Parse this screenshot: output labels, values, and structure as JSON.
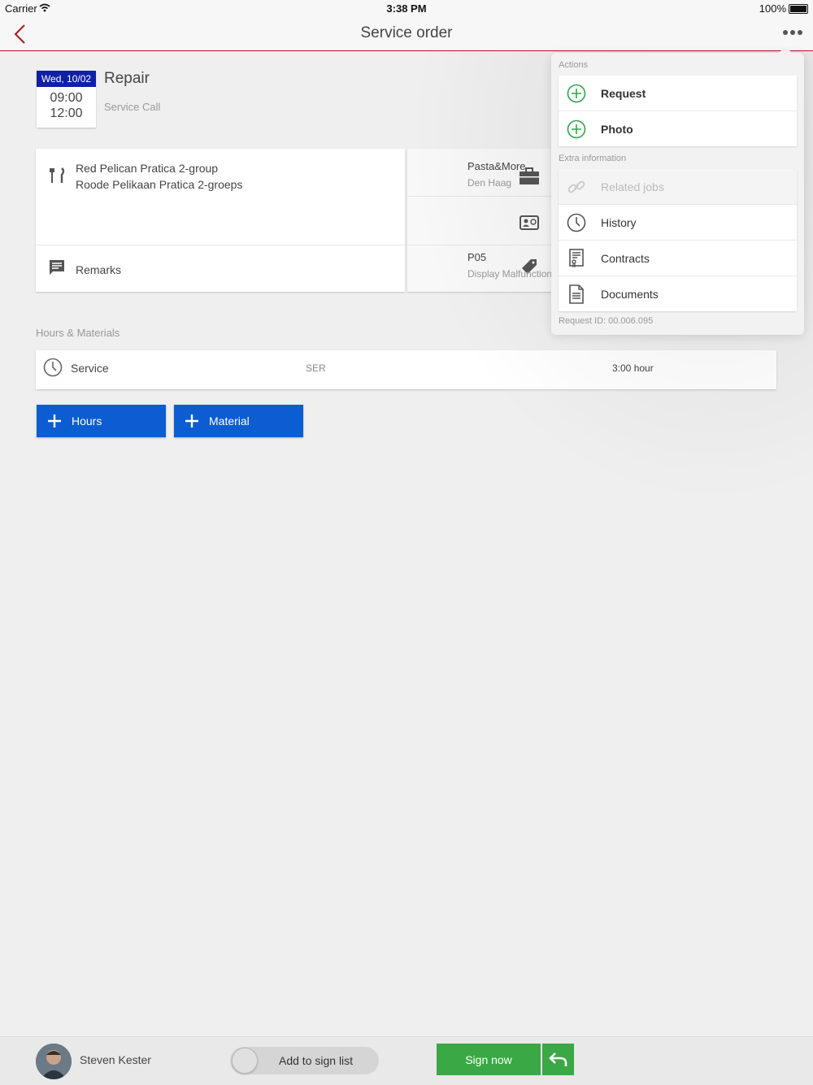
{
  "status": {
    "carrier": "Carrier",
    "time": "3:38 PM",
    "battery": "100%"
  },
  "nav": {
    "title": "Service order",
    "back_icon": "chevron-left-icon",
    "more_icon": "more-dots-icon",
    "accent": "#b0151f"
  },
  "job": {
    "day": "Wed, 10/02",
    "start": "09:00",
    "end": "12:00",
    "title": "Repair",
    "subtitle": "Service Call"
  },
  "customer": {
    "name_line1": "Red Pelican Pratica 2-group",
    "name_line2": "Roode Pelikaan Pratica 2-groeps",
    "remarks_label": "Remarks"
  },
  "right_card": {
    "company": "Pasta&More",
    "city": "Den Haag",
    "code": "P05",
    "problem": "Display Malfunction"
  },
  "hours_materials": {
    "section_title": "Hours & Materials",
    "rows": [
      {
        "name": "Service",
        "code": "SER",
        "qty": "3:00 hour"
      }
    ],
    "add_hours_label": "Hours",
    "add_material_label": "Material"
  },
  "popover": {
    "actions_label": "Actions",
    "actions": [
      {
        "label": "Request",
        "icon": "plus-circle-icon"
      },
      {
        "label": "Photo",
        "icon": "plus-circle-icon"
      }
    ],
    "extra_label": "Extra information",
    "extra": [
      {
        "label": "Related jobs",
        "icon": "link-icon"
      },
      {
        "label": "History",
        "icon": "clock-icon"
      },
      {
        "label": "Contracts",
        "icon": "contract-icon"
      },
      {
        "label": "Documents",
        "icon": "document-icon"
      }
    ],
    "footer": "Request ID: 00.006.095"
  },
  "bottom": {
    "user": "Steven Kester",
    "sign_list_label": "Add to sign list",
    "sign_now_label": "Sign now",
    "accent_green": "#3aa844",
    "accent_blue": "#0c5dd1"
  }
}
